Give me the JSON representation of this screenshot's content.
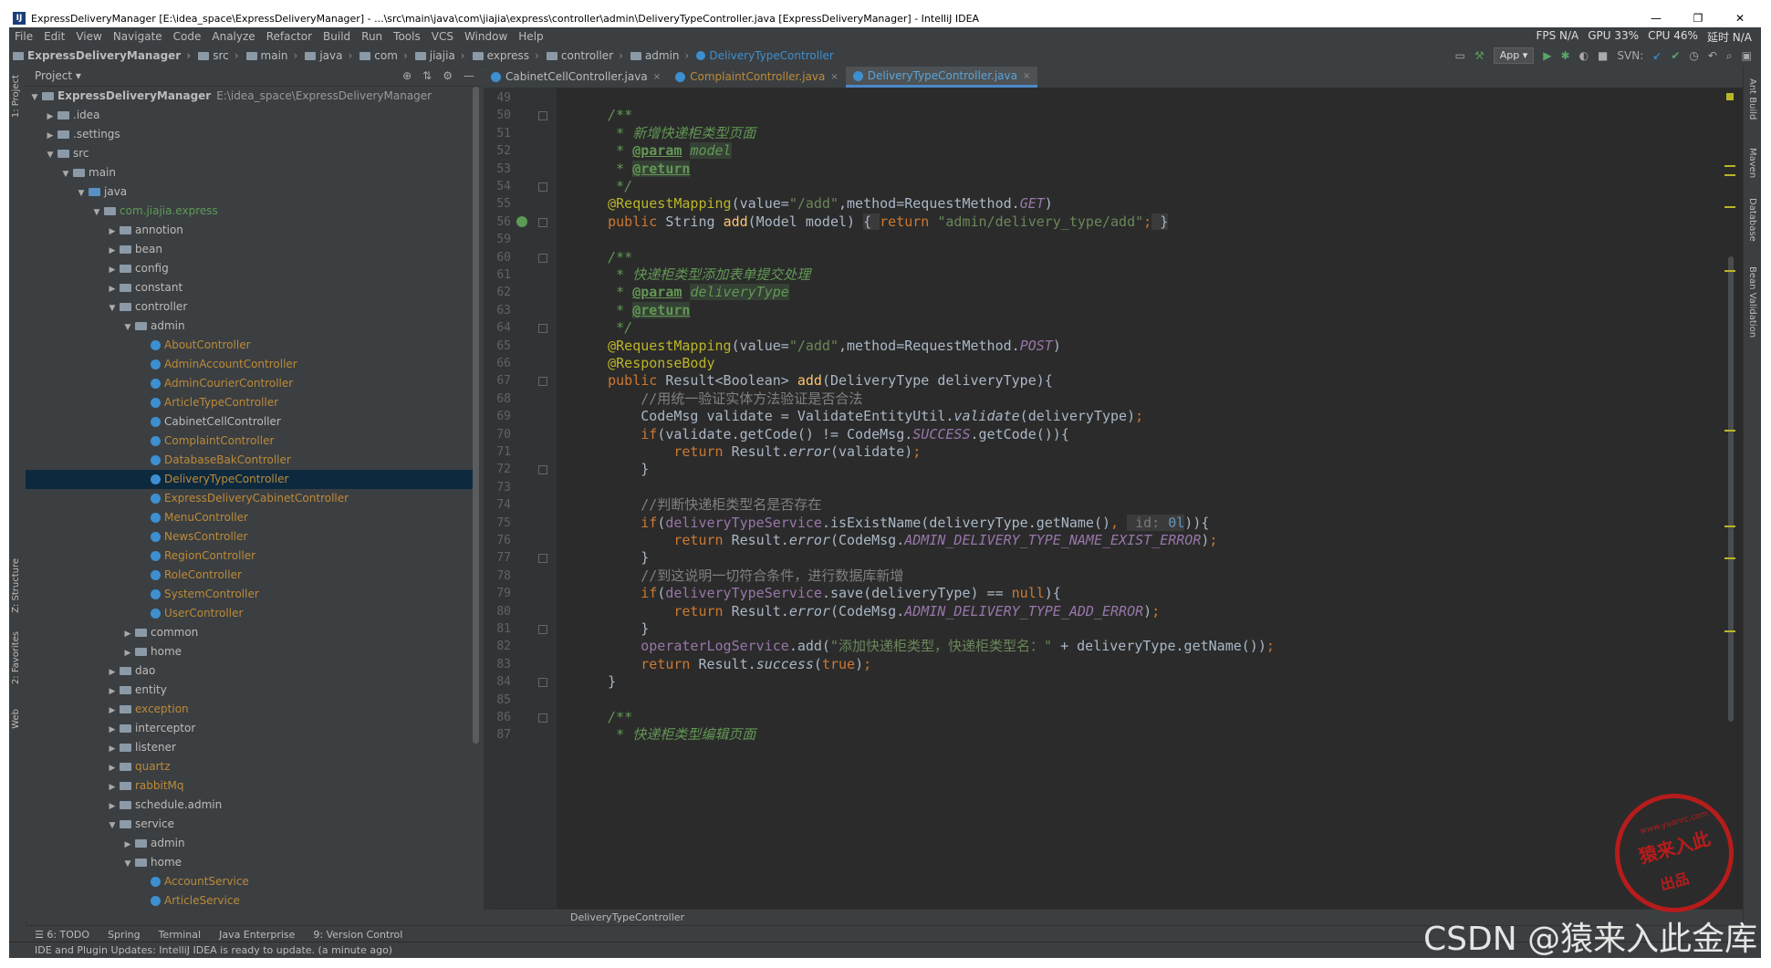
{
  "window": {
    "title": "ExpressDeliveryManager [E:\\idea_space\\ExpressDeliveryManager] - ...\\src\\main\\java\\com\\jiajia\\express\\controller\\admin\\DeliveryTypeController.java [ExpressDeliveryManager] - IntelliJ IDEA",
    "min": "—",
    "max": "❐",
    "close": "✕"
  },
  "menu": [
    "File",
    "Edit",
    "View",
    "Navigate",
    "Code",
    "Analyze",
    "Refactor",
    "Build",
    "Run",
    "Tools",
    "VCS",
    "Window",
    "Help"
  ],
  "monitor": {
    "fps": "FPS  N/A",
    "gpu": "GPU  33%",
    "cpu": "CPU  46%",
    "delay": "延时  N/A"
  },
  "breadcrumb": [
    "ExpressDeliveryManager",
    "src",
    "main",
    "java",
    "com",
    "jiajia",
    "express",
    "controller",
    "admin",
    "DeliveryTypeController"
  ],
  "toolbar": {
    "run_config": "App ▾",
    "svn": "SVN:"
  },
  "project_panel": {
    "title": "Project ▾"
  },
  "tree": [
    {
      "t": "ExpressDeliveryManager",
      "path": "E:\\idea_space\\ExpressDeliveryManager",
      "d": 0,
      "arr": "▼",
      "kind": "folder",
      "bold": true
    },
    {
      "t": ".idea",
      "d": 1,
      "arr": "▶",
      "kind": "folder"
    },
    {
      "t": ".settings",
      "d": 1,
      "arr": "▶",
      "kind": "folder"
    },
    {
      "t": "src",
      "d": 1,
      "arr": "▼",
      "kind": "folder"
    },
    {
      "t": "main",
      "d": 2,
      "arr": "▼",
      "kind": "folder"
    },
    {
      "t": "java",
      "d": 3,
      "arr": "▼",
      "kind": "bluefolder"
    },
    {
      "t": "com.jiajia.express",
      "d": 4,
      "arr": "▼",
      "kind": "folder",
      "color": "green"
    },
    {
      "t": "annotion",
      "d": 5,
      "arr": "▶",
      "kind": "folder"
    },
    {
      "t": "bean",
      "d": 5,
      "arr": "▶",
      "kind": "folder"
    },
    {
      "t": "config",
      "d": 5,
      "arr": "▶",
      "kind": "folder"
    },
    {
      "t": "constant",
      "d": 5,
      "arr": "▶",
      "kind": "folder"
    },
    {
      "t": "controller",
      "d": 5,
      "arr": "▼",
      "kind": "folder"
    },
    {
      "t": "admin",
      "d": 6,
      "arr": "▼",
      "kind": "folder"
    },
    {
      "t": "AboutController",
      "d": 7,
      "kind": "class",
      "color": "orange"
    },
    {
      "t": "AdminAccountController",
      "d": 7,
      "kind": "class",
      "color": "orange"
    },
    {
      "t": "AdminCourierController",
      "d": 7,
      "kind": "class",
      "color": "orange"
    },
    {
      "t": "ArticleTypeController",
      "d": 7,
      "kind": "class",
      "color": "orange"
    },
    {
      "t": "CabinetCellController",
      "d": 7,
      "kind": "class"
    },
    {
      "t": "ComplaintController",
      "d": 7,
      "kind": "class",
      "color": "orange"
    },
    {
      "t": "DatabaseBakController",
      "d": 7,
      "kind": "class",
      "color": "orange"
    },
    {
      "t": "DeliveryTypeController",
      "d": 7,
      "kind": "class",
      "color": "orange",
      "sel": true
    },
    {
      "t": "ExpressDeliveryCabinetController",
      "d": 7,
      "kind": "class",
      "color": "orange"
    },
    {
      "t": "MenuController",
      "d": 7,
      "kind": "class",
      "color": "orange"
    },
    {
      "t": "NewsController",
      "d": 7,
      "kind": "class",
      "color": "orange"
    },
    {
      "t": "RegionController",
      "d": 7,
      "kind": "class",
      "color": "orange"
    },
    {
      "t": "RoleController",
      "d": 7,
      "kind": "class",
      "color": "orange"
    },
    {
      "t": "SystemController",
      "d": 7,
      "kind": "class",
      "color": "orange"
    },
    {
      "t": "UserController",
      "d": 7,
      "kind": "class",
      "color": "orange"
    },
    {
      "t": "common",
      "d": 6,
      "arr": "▶",
      "kind": "folder"
    },
    {
      "t": "home",
      "d": 6,
      "arr": "▶",
      "kind": "folder"
    },
    {
      "t": "dao",
      "d": 5,
      "arr": "▶",
      "kind": "folder"
    },
    {
      "t": "entity",
      "d": 5,
      "arr": "▶",
      "kind": "folder"
    },
    {
      "t": "exception",
      "d": 5,
      "arr": "▶",
      "kind": "folder",
      "color": "orange"
    },
    {
      "t": "interceptor",
      "d": 5,
      "arr": "▶",
      "kind": "folder"
    },
    {
      "t": "listener",
      "d": 5,
      "arr": "▶",
      "kind": "folder"
    },
    {
      "t": "quartz",
      "d": 5,
      "arr": "▶",
      "kind": "folder",
      "color": "orange"
    },
    {
      "t": "rabbitMq",
      "d": 5,
      "arr": "▶",
      "kind": "folder",
      "color": "orange"
    },
    {
      "t": "schedule.admin",
      "d": 5,
      "arr": "▶",
      "kind": "folder"
    },
    {
      "t": "service",
      "d": 5,
      "arr": "▼",
      "kind": "folder"
    },
    {
      "t": "admin",
      "d": 6,
      "arr": "▶",
      "kind": "folder"
    },
    {
      "t": "home",
      "d": 6,
      "arr": "▼",
      "kind": "folder"
    },
    {
      "t": "AccountService",
      "d": 7,
      "kind": "class",
      "color": "orange"
    },
    {
      "t": "ArticleService",
      "d": 7,
      "kind": "class",
      "color": "orange"
    }
  ],
  "tabs": [
    {
      "label": "CabinetCellController.java",
      "active": false
    },
    {
      "label": "ComplaintController.java",
      "active": false,
      "color": "orange"
    },
    {
      "label": "DeliveryTypeController.java",
      "active": true
    }
  ],
  "code": [
    {
      "n": "49",
      "h": ""
    },
    {
      "n": "50",
      "h": "    <span class='cj'>/**</span>"
    },
    {
      "n": "51",
      "h": "     <span class='cj'>* 新增快递柜类型页面</span>"
    },
    {
      "n": "52",
      "h": "     <span class='cj'>* </span><span class='tg'>@param</span><span class='cj'> </span><span class='cj ph'>model</span>"
    },
    {
      "n": "53",
      "h": "     <span class='cj'>* </span><span class='tg ph'>@return</span>"
    },
    {
      "n": "54",
      "h": "     <span class='cj'>*/</span>"
    },
    {
      "n": "55",
      "h": "    <span class='a'>@RequestMapping</span><span class='p'>(value=</span><span class='s'>\"/add\"</span><span class='p'>,method=RequestMethod.</span><span class='f'>GET</span><span class='p'>)</span>"
    },
    {
      "n": "56",
      "h": "    <span class='k'>public </span><span class='p'>String </span><span class='m'>add</span><span class='p'>(Model model) </span><span class='p hl'>{ </span><span class='k'>return </span><span class='s'>\"admin/delivery_type/add\"</span><span class='k'>;</span><span class='p hl'> }</span>"
    },
    {
      "n": "59",
      "h": ""
    },
    {
      "n": "60",
      "h": "    <span class='cj'>/**</span>"
    },
    {
      "n": "61",
      "h": "     <span class='cj'>* 快递柜类型添加表单提交处理</span>"
    },
    {
      "n": "62",
      "h": "     <span class='cj'>* </span><span class='tg'>@param</span><span class='cj'> </span><span class='cj ph'>deliveryType</span>"
    },
    {
      "n": "63",
      "h": "     <span class='cj'>* </span><span class='tg ph'>@return</span>"
    },
    {
      "n": "64",
      "h": "     <span class='cj'>*/</span>"
    },
    {
      "n": "65",
      "h": "    <span class='a'>@RequestMapping</span><span class='p'>(value=</span><span class='s'>\"/add\"</span><span class='p'>,method=RequestMethod.</span><span class='f'>POST</span><span class='p'>)</span>"
    },
    {
      "n": "66",
      "h": "    <span class='a'>@ResponseBody</span>"
    },
    {
      "n": "67",
      "h": "    <span class='k'>public </span><span class='p'>Result&lt;Boolean&gt; </span><span class='m'>add</span><span class='p'>(DeliveryType deliveryType){</span>"
    },
    {
      "n": "68",
      "h": "        <span class='c'>//用统一验证实体方法验证是否合法</span>"
    },
    {
      "n": "69",
      "h": "        <span class='p'>CodeMsg validate = ValidateEntityUtil.</span><span class='p it'>validate</span><span class='p'>(deliveryType)</span><span class='k'>;</span>"
    },
    {
      "n": "70",
      "h": "        <span class='k'>if</span><span class='p'>(validate.getCode() != CodeMsg.</span><span class='f'>SUCCESS</span><span class='p'>.getCode()){</span>"
    },
    {
      "n": "71",
      "h": "            <span class='k'>return </span><span class='p'>Result.</span><span class='p it'>error</span><span class='p'>(validate)</span><span class='k'>;</span>"
    },
    {
      "n": "72",
      "h": "        <span class='p'>}</span>"
    },
    {
      "n": "73",
      "h": ""
    },
    {
      "n": "74",
      "h": "        <span class='c'>//判断快递柜类型名是否存在</span>"
    },
    {
      "n": "75",
      "h": "        <span class='k'>if</span><span class='p'>(</span><span class='f' style='font-style:normal'>deliveryTypeService</span><span class='p'>.isExistName(deliveryType.getName()</span><span class='k'>, </span><span class='hint'> id: </span><span class='hint' style='color:#6897bb'>0l</span><span class='p'>)){</span>"
    },
    {
      "n": "76",
      "h": "            <span class='k'>return </span><span class='p'>Result.</span><span class='p it'>error</span><span class='p'>(CodeMsg.</span><span class='f'>ADMIN_DELIVERY_TYPE_NAME_EXIST_ERROR</span><span class='p'>)</span><span class='k'>;</span>"
    },
    {
      "n": "77",
      "h": "        <span class='p'>}</span>"
    },
    {
      "n": "78",
      "h": "        <span class='c'>//到这说明一切符合条件，进行数据库新增</span>"
    },
    {
      "n": "79",
      "h": "        <span class='k'>if</span><span class='p'>(</span><span class='f' style='font-style:normal'>deliveryTypeService</span><span class='p'>.save(deliveryType) == </span><span class='k'>null</span><span class='p'>){</span>"
    },
    {
      "n": "80",
      "h": "            <span class='k'>return </span><span class='p'>Result.</span><span class='p it'>error</span><span class='p'>(CodeMsg.</span><span class='f'>ADMIN_DELIVERY_TYPE_ADD_ERROR</span><span class='p'>)</span><span class='k'>;</span>"
    },
    {
      "n": "81",
      "h": "        <span class='p'>}</span>"
    },
    {
      "n": "82",
      "h": "        <span class='f' style='font-style:normal'>operaterLogService</span><span class='p'>.add(</span><span class='s'>\"添加快递柜类型，快递柜类型名：\" </span><span class='p'>+ deliveryType.getName())</span><span class='k'>;</span>"
    },
    {
      "n": "83",
      "h": "        <span class='k'>return </span><span class='p'>Result.</span><span class='p it'>success</span><span class='p'>(</span><span class='k'>true</span><span class='p'>)</span><span class='k'>;</span>"
    },
    {
      "n": "84",
      "h": "    <span class='p'>}</span>"
    },
    {
      "n": "85",
      "h": ""
    },
    {
      "n": "86",
      "h": "    <span class='cj'>/**</span>"
    },
    {
      "n": "87",
      "h": "     <span class='cj'>* 快递柜类型编辑页面</span>"
    }
  ],
  "editor_breadcrumb": "DeliveryTypeController",
  "toolwindows": [
    "☰ 6: TODO",
    "Spring",
    "Terminal",
    "Java Enterprise",
    "9: Version Control"
  ],
  "status": "IDE and Plugin Updates: IntelliJ IDEA is ready to update. (a minute ago)",
  "left_tabs": {
    "project": "1: Project",
    "structure": "Z: Structure",
    "favorites": "2: Favorites",
    "web": "Web"
  },
  "right_tabs": {
    "ant": "Ant Build",
    "maven": "Maven",
    "database": "Database",
    "bean": "Bean Validation"
  },
  "watermark": "CSDN @猿来入此金库",
  "stamp": {
    "url": "www.yuanrc.com",
    "main": "猿来入此",
    "sub": "出品"
  }
}
